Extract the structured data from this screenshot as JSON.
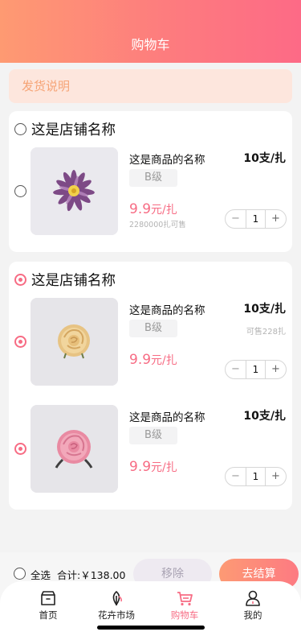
{
  "header": {
    "title": "购物车"
  },
  "notice": {
    "text": "发货说明"
  },
  "shops": [
    {
      "name": "这是店铺名称",
      "selected": false,
      "items": [
        {
          "name": "这是商品的名称",
          "unit": "10支/扎",
          "grade": "B级",
          "price": "9.9",
          "price_unit": "元/扎",
          "stock_left": "2280000扎可售",
          "stock_right": "",
          "qty": "1",
          "selected": false,
          "image": "purple-dried-daisy"
        }
      ]
    },
    {
      "name": "这是店铺名称",
      "selected": true,
      "items": [
        {
          "name": "这是商品的名称",
          "unit": "10支/扎",
          "grade": "B级",
          "price": "9.9",
          "price_unit": "元/扎",
          "stock_left": "",
          "stock_right": "可售228扎",
          "qty": "1",
          "selected": true,
          "image": "champagne-rose"
        },
        {
          "name": "这是商品的名称",
          "unit": "10支/扎",
          "grade": "B级",
          "price": "9.9",
          "price_unit": "元/扎",
          "stock_left": "",
          "stock_right": "",
          "qty": "1",
          "selected": true,
          "image": "pink-rose"
        }
      ]
    }
  ],
  "stepper": {
    "minus": "−",
    "plus": "+"
  },
  "footer": {
    "select_all": "全选",
    "total": "合计:￥138.00",
    "remove": "移除",
    "checkout": "去结算"
  },
  "tabs": [
    {
      "label": "首页",
      "icon": "home-icon"
    },
    {
      "label": "花卉市场",
      "icon": "flower-market-icon"
    },
    {
      "label": "购物车",
      "icon": "cart-icon",
      "active": true
    },
    {
      "label": "我的",
      "icon": "user-icon"
    }
  ],
  "colors": {
    "accent": "#f76c84",
    "header_start": "#fe9a72",
    "header_end": "#fd6a86",
    "notice_bg": "#fde6dd",
    "notice_text": "#f6a476"
  }
}
